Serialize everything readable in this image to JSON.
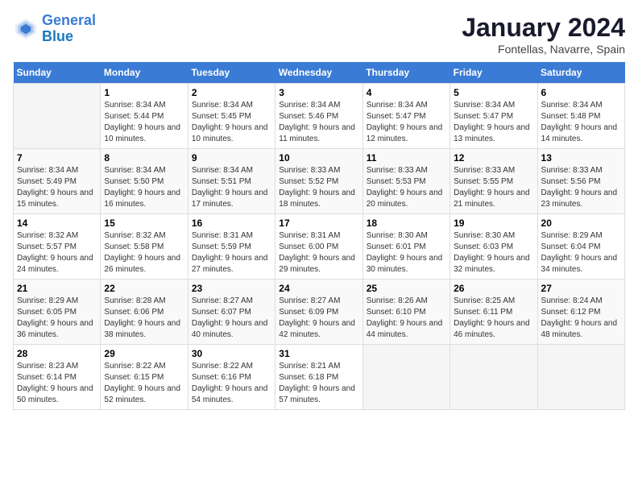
{
  "logo": {
    "line1": "General",
    "line2": "Blue"
  },
  "title": "January 2024",
  "subtitle": "Fontellas, Navarre, Spain",
  "days_header": [
    "Sunday",
    "Monday",
    "Tuesday",
    "Wednesday",
    "Thursday",
    "Friday",
    "Saturday"
  ],
  "weeks": [
    [
      {
        "day": "",
        "sunrise": "",
        "sunset": "",
        "daylight": ""
      },
      {
        "day": "1",
        "sunrise": "Sunrise: 8:34 AM",
        "sunset": "Sunset: 5:44 PM",
        "daylight": "Daylight: 9 hours and 10 minutes."
      },
      {
        "day": "2",
        "sunrise": "Sunrise: 8:34 AM",
        "sunset": "Sunset: 5:45 PM",
        "daylight": "Daylight: 9 hours and 10 minutes."
      },
      {
        "day": "3",
        "sunrise": "Sunrise: 8:34 AM",
        "sunset": "Sunset: 5:46 PM",
        "daylight": "Daylight: 9 hours and 11 minutes."
      },
      {
        "day": "4",
        "sunrise": "Sunrise: 8:34 AM",
        "sunset": "Sunset: 5:47 PM",
        "daylight": "Daylight: 9 hours and 12 minutes."
      },
      {
        "day": "5",
        "sunrise": "Sunrise: 8:34 AM",
        "sunset": "Sunset: 5:47 PM",
        "daylight": "Daylight: 9 hours and 13 minutes."
      },
      {
        "day": "6",
        "sunrise": "Sunrise: 8:34 AM",
        "sunset": "Sunset: 5:48 PM",
        "daylight": "Daylight: 9 hours and 14 minutes."
      }
    ],
    [
      {
        "day": "7",
        "sunrise": "Sunrise: 8:34 AM",
        "sunset": "Sunset: 5:49 PM",
        "daylight": "Daylight: 9 hours and 15 minutes."
      },
      {
        "day": "8",
        "sunrise": "Sunrise: 8:34 AM",
        "sunset": "Sunset: 5:50 PM",
        "daylight": "Daylight: 9 hours and 16 minutes."
      },
      {
        "day": "9",
        "sunrise": "Sunrise: 8:34 AM",
        "sunset": "Sunset: 5:51 PM",
        "daylight": "Daylight: 9 hours and 17 minutes."
      },
      {
        "day": "10",
        "sunrise": "Sunrise: 8:33 AM",
        "sunset": "Sunset: 5:52 PM",
        "daylight": "Daylight: 9 hours and 18 minutes."
      },
      {
        "day": "11",
        "sunrise": "Sunrise: 8:33 AM",
        "sunset": "Sunset: 5:53 PM",
        "daylight": "Daylight: 9 hours and 20 minutes."
      },
      {
        "day": "12",
        "sunrise": "Sunrise: 8:33 AM",
        "sunset": "Sunset: 5:55 PM",
        "daylight": "Daylight: 9 hours and 21 minutes."
      },
      {
        "day": "13",
        "sunrise": "Sunrise: 8:33 AM",
        "sunset": "Sunset: 5:56 PM",
        "daylight": "Daylight: 9 hours and 23 minutes."
      }
    ],
    [
      {
        "day": "14",
        "sunrise": "Sunrise: 8:32 AM",
        "sunset": "Sunset: 5:57 PM",
        "daylight": "Daylight: 9 hours and 24 minutes."
      },
      {
        "day": "15",
        "sunrise": "Sunrise: 8:32 AM",
        "sunset": "Sunset: 5:58 PM",
        "daylight": "Daylight: 9 hours and 26 minutes."
      },
      {
        "day": "16",
        "sunrise": "Sunrise: 8:31 AM",
        "sunset": "Sunset: 5:59 PM",
        "daylight": "Daylight: 9 hours and 27 minutes."
      },
      {
        "day": "17",
        "sunrise": "Sunrise: 8:31 AM",
        "sunset": "Sunset: 6:00 PM",
        "daylight": "Daylight: 9 hours and 29 minutes."
      },
      {
        "day": "18",
        "sunrise": "Sunrise: 8:30 AM",
        "sunset": "Sunset: 6:01 PM",
        "daylight": "Daylight: 9 hours and 30 minutes."
      },
      {
        "day": "19",
        "sunrise": "Sunrise: 8:30 AM",
        "sunset": "Sunset: 6:03 PM",
        "daylight": "Daylight: 9 hours and 32 minutes."
      },
      {
        "day": "20",
        "sunrise": "Sunrise: 8:29 AM",
        "sunset": "Sunset: 6:04 PM",
        "daylight": "Daylight: 9 hours and 34 minutes."
      }
    ],
    [
      {
        "day": "21",
        "sunrise": "Sunrise: 8:29 AM",
        "sunset": "Sunset: 6:05 PM",
        "daylight": "Daylight: 9 hours and 36 minutes."
      },
      {
        "day": "22",
        "sunrise": "Sunrise: 8:28 AM",
        "sunset": "Sunset: 6:06 PM",
        "daylight": "Daylight: 9 hours and 38 minutes."
      },
      {
        "day": "23",
        "sunrise": "Sunrise: 8:27 AM",
        "sunset": "Sunset: 6:07 PM",
        "daylight": "Daylight: 9 hours and 40 minutes."
      },
      {
        "day": "24",
        "sunrise": "Sunrise: 8:27 AM",
        "sunset": "Sunset: 6:09 PM",
        "daylight": "Daylight: 9 hours and 42 minutes."
      },
      {
        "day": "25",
        "sunrise": "Sunrise: 8:26 AM",
        "sunset": "Sunset: 6:10 PM",
        "daylight": "Daylight: 9 hours and 44 minutes."
      },
      {
        "day": "26",
        "sunrise": "Sunrise: 8:25 AM",
        "sunset": "Sunset: 6:11 PM",
        "daylight": "Daylight: 9 hours and 46 minutes."
      },
      {
        "day": "27",
        "sunrise": "Sunrise: 8:24 AM",
        "sunset": "Sunset: 6:12 PM",
        "daylight": "Daylight: 9 hours and 48 minutes."
      }
    ],
    [
      {
        "day": "28",
        "sunrise": "Sunrise: 8:23 AM",
        "sunset": "Sunset: 6:14 PM",
        "daylight": "Daylight: 9 hours and 50 minutes."
      },
      {
        "day": "29",
        "sunrise": "Sunrise: 8:22 AM",
        "sunset": "Sunset: 6:15 PM",
        "daylight": "Daylight: 9 hours and 52 minutes."
      },
      {
        "day": "30",
        "sunrise": "Sunrise: 8:22 AM",
        "sunset": "Sunset: 6:16 PM",
        "daylight": "Daylight: 9 hours and 54 minutes."
      },
      {
        "day": "31",
        "sunrise": "Sunrise: 8:21 AM",
        "sunset": "Sunset: 6:18 PM",
        "daylight": "Daylight: 9 hours and 57 minutes."
      },
      {
        "day": "",
        "sunrise": "",
        "sunset": "",
        "daylight": ""
      },
      {
        "day": "",
        "sunrise": "",
        "sunset": "",
        "daylight": ""
      },
      {
        "day": "",
        "sunrise": "",
        "sunset": "",
        "daylight": ""
      }
    ]
  ]
}
